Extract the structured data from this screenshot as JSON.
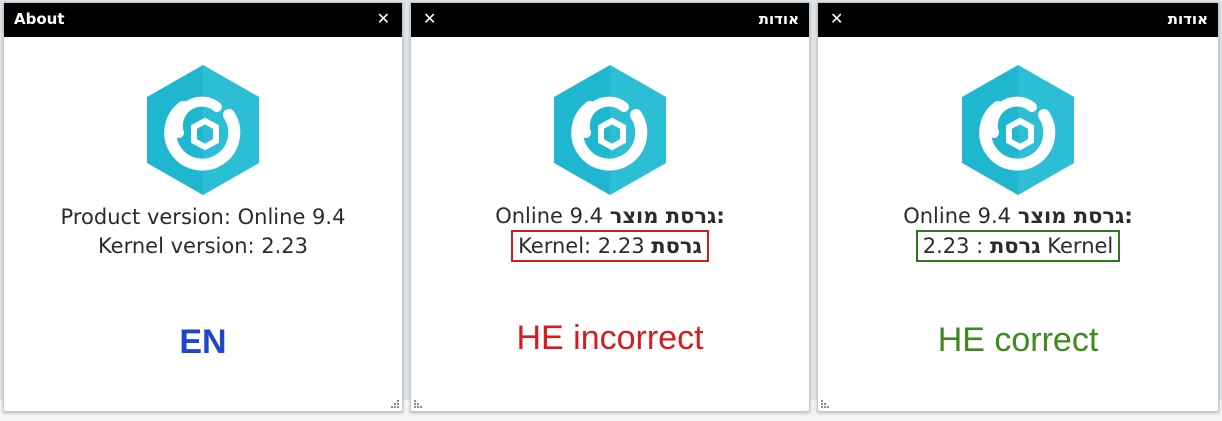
{
  "colors": {
    "titlebar_bg": "#000000",
    "logo_teal": "#1fb6cf",
    "caption_en": "#1f47c8",
    "caption_incorrect": "#d41e1e",
    "caption_correct": "#3f8a1f",
    "highlight_incorrect": "#cc1f1f",
    "highlight_correct": "#2f7a1f"
  },
  "panels": [
    {
      "title": "About",
      "close_icon": "close-icon",
      "logo_icon": "app-logo-icon",
      "product_line": "Product version: Online 9.4",
      "kernel_line": "Kernel version: 2.23",
      "caption": "EN"
    },
    {
      "title": "אודות",
      "close_icon": "close-icon",
      "logo_icon": "app-logo-icon",
      "product_prefix": "Online 9.4",
      "product_suffix": "גרסת מוצר:",
      "kernel_prefix": "Kernel: 2.23",
      "kernel_suffix": "גרסת",
      "caption": "HE incorrect"
    },
    {
      "title": "אודות",
      "close_icon": "close-icon",
      "logo_icon": "app-logo-icon",
      "product_prefix": "Online 9.4",
      "product_suffix": "גרסת מוצר:",
      "kernel_prefix": "2.23 :",
      "kernel_middle": "גרסת",
      "kernel_suffix": "Kernel",
      "caption": "HE correct"
    }
  ]
}
